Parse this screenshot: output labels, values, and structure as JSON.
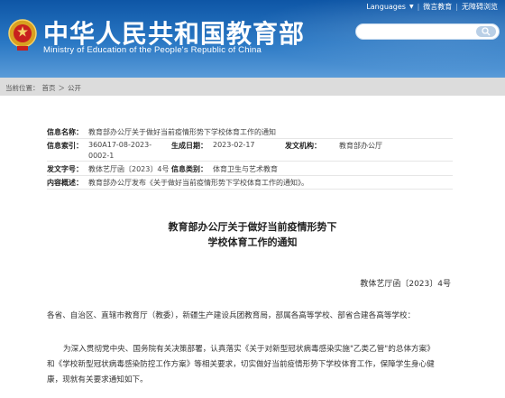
{
  "header": {
    "title": "中华人民共和国教育部",
    "subtitle": "Ministry of Education of the People's Republic of China",
    "links": [
      "Languages",
      "微言教育",
      "无障碍浏览"
    ],
    "search_placeholder": ""
  },
  "breadcrumb": [
    "当前位置：",
    "首页",
    "＞",
    "公开"
  ],
  "meta": {
    "info_name_label": "信息名称：",
    "info_name_value": "教育部办公厅关于做好当前疫情形势下学校体育工作的通知",
    "index_label": "信息索引：",
    "index_value_1": "360A17-08-2023-",
    "index_value_2": "0002-1",
    "date_label": "生成日期：",
    "date_value": "2023-02-17",
    "org_label": "发文机构：",
    "org_value": "教育部办公厅",
    "docno_label": "发文字号：",
    "docno_value": "教体艺厅函〔2023〕4号",
    "category_label": "信息类别：",
    "category_value": "体育卫生与艺术教育",
    "summary_label": "内容概述：",
    "summary_value": "教育部办公厅发布《关于做好当前疫情形势下学校体育工作的通知》。"
  },
  "document": {
    "title_line1": "教育部办公厅关于做好当前疫情形势下",
    "title_line2": "学校体育工作的通知",
    "doc_number": "教体艺厅函〔2023〕4号",
    "recipients": "各省、自治区、直辖市教育厅（教委），新疆生产建设兵团教育局，部属各高等学校、部省合建各高等学校：",
    "body_line1": "为深入贯彻党中央、国务院有关决策部署，认真落实《关于对新型冠状病毒感染实施\"乙类乙管\"的总体方案》",
    "body_line2": "和《学校新型冠状病毒感染防控工作方案》等相关要求，切实做好当前疫情形势下学校体育工作，保障学生身心健",
    "body_line3": "康，现就有关要求通知如下。"
  },
  "colors": {
    "header_dark": "#0e56a6",
    "header_light": "#5a9bd8",
    "page_bg": "#dcdcdc"
  }
}
